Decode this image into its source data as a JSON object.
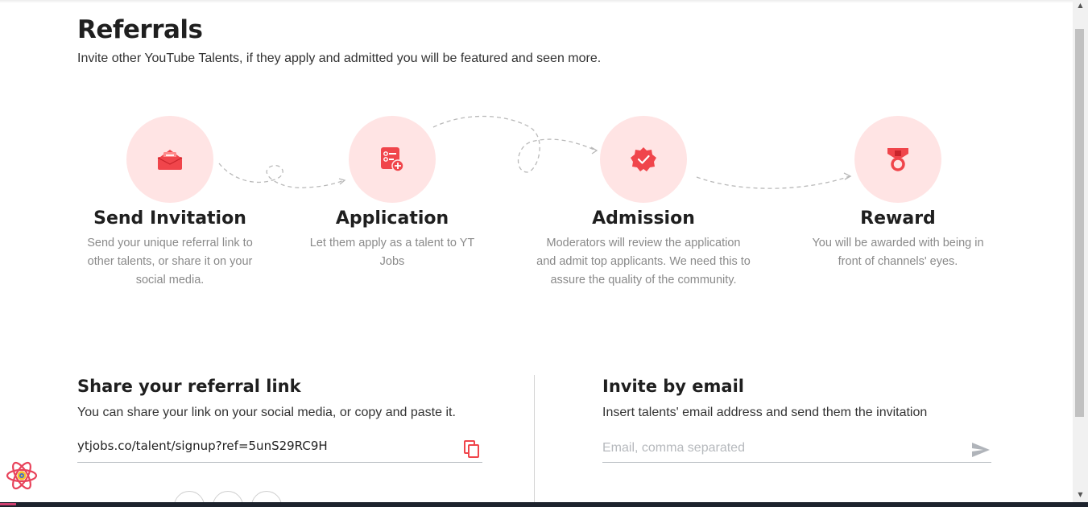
{
  "header": {
    "title": "Referrals",
    "subtitle": "Invite other YouTube Talents, if they apply and admitted you will be featured and seen more."
  },
  "steps": [
    {
      "icon": "envelope-icon",
      "title": "Send Invitation",
      "desc_lines": [
        "Send your unique referral link to",
        "other talents, or share it on your",
        "social media."
      ]
    },
    {
      "icon": "application-form-icon",
      "title": "Application",
      "desc_lines": [
        "Let them apply as a talent to YT",
        "Jobs"
      ]
    },
    {
      "icon": "verified-badge-icon",
      "title": "Admission",
      "desc_lines": [
        "Moderators will review the application",
        "and admit top applicants. We need this to",
        "assure the quality of the community."
      ]
    },
    {
      "icon": "medal-icon",
      "title": "Reward",
      "desc_lines": [
        "You will be awarded with being in",
        "front of channels' eyes."
      ]
    }
  ],
  "share": {
    "title": "Share your referral link",
    "desc": "You can share your link on your social media, or copy and paste it.",
    "link": "ytjobs.co/talent/signup?ref=5unS29RC9H"
  },
  "invite": {
    "title": "Invite by email",
    "desc": "Insert talents' email address and send them the invitation",
    "placeholder": "Email, comma separated"
  },
  "colors": {
    "accent": "#f0454b",
    "circle_bg": "#ffe4e4"
  }
}
